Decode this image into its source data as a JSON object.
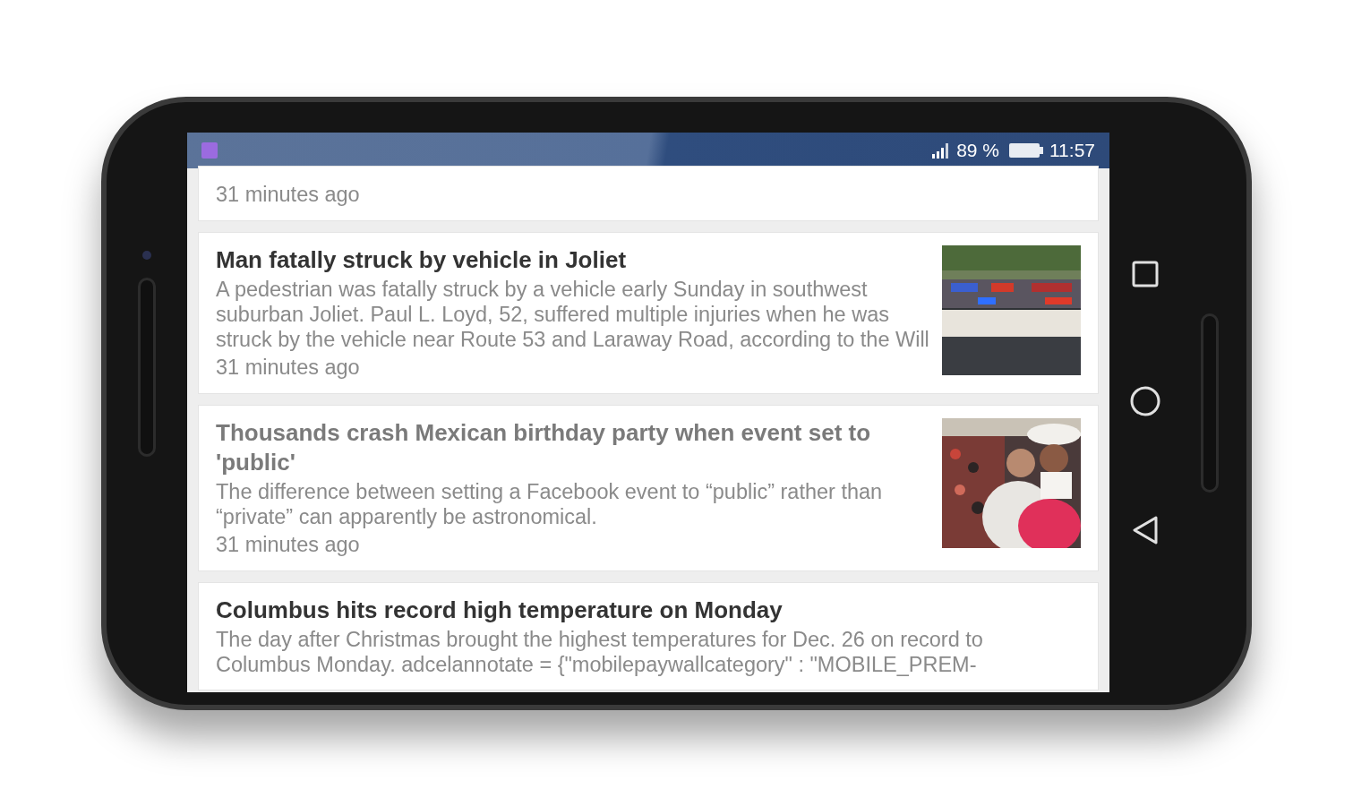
{
  "status_bar": {
    "battery": "89 %",
    "time": "11:57"
  },
  "articles": [
    {
      "time": "31 minutes ago"
    },
    {
      "title": "Man fatally struck by vehicle in Joliet",
      "summary": "A pedestrian was fatally struck by a vehicle early Sunday in southwest suburban Joliet. Paul L. Loyd, 52, suffered multiple injuries when he was struck by the vehicle near Route 53 and Laraway Road, according to the Will",
      "time": "31 minutes ago",
      "read": false,
      "image": true
    },
    {
      "title": "Thousands crash Mexican birthday party when event set to 'public'",
      "summary": "The difference between setting a Facebook event to “public” rather than “private” can apparently be astronomical.",
      "time": "31 minutes ago",
      "read": true,
      "image": true
    },
    {
      "title": "Columbus hits record high temperature on Monday",
      "summary": "The day after Christmas brought the highest temperatures for Dec. 26 on record to Columbus Monday. adcelannotate = {\"mobilepaywallcategory\" : \"MOBILE_PREM-",
      "read": false
    }
  ]
}
